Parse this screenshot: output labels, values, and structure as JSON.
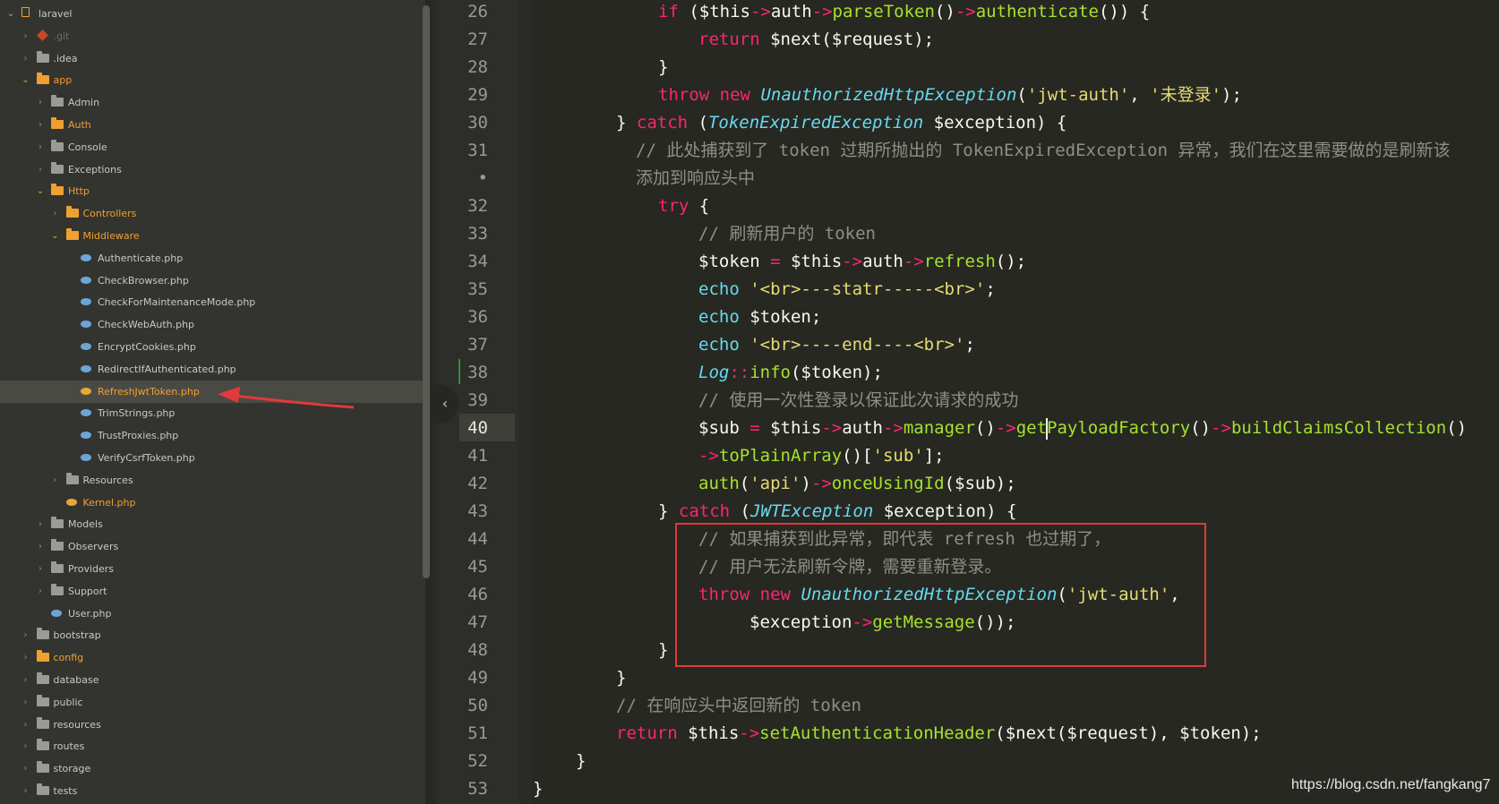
{
  "sidebar": {
    "items": [
      {
        "label": "laravel",
        "kind": "project",
        "chevron": "open",
        "color": "normal",
        "icon": "project-icon"
      },
      {
        "label": ".git",
        "kind": "git",
        "chevron": "closed",
        "color": "dim",
        "icon": "git-icon"
      },
      {
        "label": ".idea",
        "kind": "folder",
        "chevron": "closed",
        "color": "normal",
        "icon": "folder-icon"
      },
      {
        "label": "app",
        "kind": "folder-orange",
        "chevron": "open",
        "color": "orange",
        "icon": "folder-icon"
      },
      {
        "label": "Admin",
        "kind": "folder",
        "chevron": "closed",
        "color": "normal",
        "icon": "folder-icon"
      },
      {
        "label": "Auth",
        "kind": "folder-orange",
        "chevron": "closed",
        "color": "orange",
        "icon": "folder-icon"
      },
      {
        "label": "Console",
        "kind": "folder",
        "chevron": "closed",
        "color": "normal",
        "icon": "folder-icon"
      },
      {
        "label": "Exceptions",
        "kind": "folder",
        "chevron": "closed",
        "color": "normal",
        "icon": "folder-icon"
      },
      {
        "label": "Http",
        "kind": "folder-orange",
        "chevron": "open",
        "color": "orange",
        "icon": "folder-icon"
      },
      {
        "label": "Controllers",
        "kind": "folder-orange",
        "chevron": "closed",
        "color": "orange",
        "icon": "folder-icon"
      },
      {
        "label": "Middleware",
        "kind": "folder-orange",
        "chevron": "open",
        "color": "orange",
        "icon": "folder-icon"
      },
      {
        "label": "Authenticate.php",
        "kind": "php",
        "chevron": "",
        "color": "normal",
        "icon": "php-file-icon"
      },
      {
        "label": "CheckBrowser.php",
        "kind": "php",
        "chevron": "",
        "color": "normal",
        "icon": "php-file-icon"
      },
      {
        "label": "CheckForMaintenanceMode.php",
        "kind": "php",
        "chevron": "",
        "color": "normal",
        "icon": "php-file-icon"
      },
      {
        "label": "CheckWebAuth.php",
        "kind": "php",
        "chevron": "",
        "color": "normal",
        "icon": "php-file-icon"
      },
      {
        "label": "EncryptCookies.php",
        "kind": "php",
        "chevron": "",
        "color": "normal",
        "icon": "php-file-icon"
      },
      {
        "label": "RedirectIfAuthenticated.php",
        "kind": "php",
        "chevron": "",
        "color": "normal",
        "icon": "php-file-icon"
      },
      {
        "label": "RefreshJwtToken.php",
        "kind": "php-orange",
        "chevron": "",
        "color": "orange",
        "icon": "php-file-icon",
        "selected": true
      },
      {
        "label": "TrimStrings.php",
        "kind": "php",
        "chevron": "",
        "color": "normal",
        "icon": "php-file-icon"
      },
      {
        "label": "TrustProxies.php",
        "kind": "php",
        "chevron": "",
        "color": "normal",
        "icon": "php-file-icon"
      },
      {
        "label": "VerifyCsrfToken.php",
        "kind": "php",
        "chevron": "",
        "color": "normal",
        "icon": "php-file-icon"
      },
      {
        "label": "Resources",
        "kind": "folder",
        "chevron": "closed",
        "color": "normal",
        "icon": "folder-icon"
      },
      {
        "label": "Kernel.php",
        "kind": "php-orange",
        "chevron": "",
        "color": "orange",
        "icon": "php-file-icon"
      },
      {
        "label": "Models",
        "kind": "folder",
        "chevron": "closed",
        "color": "normal",
        "icon": "folder-icon"
      },
      {
        "label": "Observers",
        "kind": "folder",
        "chevron": "closed",
        "color": "normal",
        "icon": "folder-icon"
      },
      {
        "label": "Providers",
        "kind": "folder",
        "chevron": "closed",
        "color": "normal",
        "icon": "folder-icon"
      },
      {
        "label": "Support",
        "kind": "folder",
        "chevron": "closed",
        "color": "normal",
        "icon": "folder-icon"
      },
      {
        "label": "User.php",
        "kind": "php",
        "chevron": "",
        "color": "normal",
        "icon": "php-file-icon"
      },
      {
        "label": "bootstrap",
        "kind": "folder",
        "chevron": "closed",
        "color": "normal",
        "icon": "folder-icon"
      },
      {
        "label": "config",
        "kind": "folder-orange",
        "chevron": "closed",
        "color": "orange",
        "icon": "folder-icon"
      },
      {
        "label": "database",
        "kind": "folder",
        "chevron": "closed",
        "color": "normal",
        "icon": "folder-icon"
      },
      {
        "label": "public",
        "kind": "folder",
        "chevron": "closed",
        "color": "normal",
        "icon": "folder-icon"
      },
      {
        "label": "resources",
        "kind": "folder",
        "chevron": "closed",
        "color": "normal",
        "icon": "folder-icon"
      },
      {
        "label": "routes",
        "kind": "folder",
        "chevron": "closed",
        "color": "normal",
        "icon": "folder-icon"
      },
      {
        "label": "storage",
        "kind": "folder",
        "chevron": "closed",
        "color": "normal",
        "icon": "folder-icon"
      },
      {
        "label": "tests",
        "kind": "folder",
        "chevron": "closed",
        "color": "normal",
        "icon": "folder-icon"
      }
    ]
  },
  "editor": {
    "current_line": "40",
    "line_numbers": [
      "26",
      "27",
      "28",
      "29",
      "30",
      "31",
      "•",
      "32",
      "33",
      "34",
      "35",
      "36",
      "37",
      "38",
      "39",
      "40",
      "41",
      "42",
      "43",
      "44",
      "45",
      "46",
      "47",
      "48",
      "49",
      "50",
      "51",
      "52",
      "53"
    ],
    "lines": [
      [
        [
          "k",
          "if"
        ],
        [
          "p",
          " ("
        ],
        [
          "v",
          "$this"
        ],
        [
          "o",
          "->"
        ],
        [
          "p",
          "auth"
        ],
        [
          "o",
          "->"
        ],
        [
          "f",
          "parseToken"
        ],
        [
          "p",
          "()"
        ],
        [
          "o",
          "->"
        ],
        [
          "f",
          "authenticate"
        ],
        [
          "p",
          "()) {"
        ]
      ],
      [
        [
          "k",
          "return"
        ],
        [
          "p",
          " $next($request);"
        ]
      ],
      [
        [
          "p",
          "}"
        ]
      ],
      [
        [
          "k",
          "throw"
        ],
        [
          "p",
          " "
        ],
        [
          "k",
          "new"
        ],
        [
          "p",
          " "
        ],
        [
          "c",
          "UnauthorizedHttpException"
        ],
        [
          "p",
          "("
        ],
        [
          "s",
          "'jwt-auth'"
        ],
        [
          "p",
          ", "
        ],
        [
          "s",
          "'未登录'"
        ],
        [
          "p",
          ");"
        ]
      ],
      [
        [
          "p",
          "} "
        ],
        [
          "k",
          "catch"
        ],
        [
          "p",
          " ("
        ],
        [
          "c",
          "TokenExpiredException"
        ],
        [
          "p",
          " $exception) {"
        ]
      ],
      [
        [
          "m",
          "// 此处捕获到了 token 过期所抛出的 TokenExpiredException 异常，我们在这里需要做的是刷新该"
        ]
      ],
      [
        [
          "m",
          "添加到响应头中"
        ]
      ],
      [
        [
          "k",
          "try"
        ],
        [
          "p",
          " {"
        ]
      ],
      [
        [
          "m",
          "// 刷新用户的 token"
        ]
      ],
      [
        [
          "p",
          "$token "
        ],
        [
          "o",
          "="
        ],
        [
          "p",
          " $this"
        ],
        [
          "o",
          "->"
        ],
        [
          "p",
          "auth"
        ],
        [
          "o",
          "->"
        ],
        [
          "f",
          "refresh"
        ],
        [
          "p",
          "();"
        ]
      ],
      [
        [
          "b",
          "echo"
        ],
        [
          "p",
          " "
        ],
        [
          "s",
          "'<br>---statr-----<br>'"
        ],
        [
          "p",
          ";"
        ]
      ],
      [
        [
          "b",
          "echo"
        ],
        [
          "p",
          " $token;"
        ]
      ],
      [
        [
          "b",
          "echo"
        ],
        [
          "p",
          " "
        ],
        [
          "s",
          "'<br>----end----<br>'"
        ],
        [
          "p",
          ";"
        ]
      ],
      [
        [
          "c",
          "Log"
        ],
        [
          "o",
          "::"
        ],
        [
          "f",
          "info"
        ],
        [
          "p",
          "($token);"
        ]
      ],
      [
        [
          "m",
          "// 使用一次性登录以保证此次请求的成功"
        ]
      ],
      [
        [
          "p",
          "$sub "
        ],
        [
          "o",
          "="
        ],
        [
          "p",
          " $this"
        ],
        [
          "o",
          "->"
        ],
        [
          "p",
          "auth"
        ],
        [
          "o",
          "->"
        ],
        [
          "f",
          "manager"
        ],
        [
          "p",
          "()"
        ],
        [
          "o",
          "->"
        ],
        [
          "f",
          "get"
        ],
        [
          "x",
          ""
        ],
        [
          "f",
          "PayloadFactory"
        ],
        [
          "p",
          "()"
        ],
        [
          "o",
          "->"
        ],
        [
          "f",
          "buildClaimsCollection"
        ],
        [
          "p",
          "()"
        ]
      ],
      [
        [
          "o",
          "->"
        ],
        [
          "f",
          "toPlainArray"
        ],
        [
          "p",
          "()["
        ],
        [
          "s",
          "'sub'"
        ],
        [
          "p",
          "];"
        ]
      ],
      [
        [
          "f",
          "auth"
        ],
        [
          "p",
          "("
        ],
        [
          "s",
          "'api'"
        ],
        [
          "p",
          ")"
        ],
        [
          "o",
          "->"
        ],
        [
          "f",
          "onceUsingId"
        ],
        [
          "p",
          "($sub);"
        ]
      ],
      [
        [
          "p",
          "} "
        ],
        [
          "k",
          "catch"
        ],
        [
          "p",
          " ("
        ],
        [
          "c",
          "JWTException"
        ],
        [
          "p",
          " $exception) {"
        ]
      ],
      [
        [
          "m",
          "// 如果捕获到此异常，即代表 refresh 也过期了，"
        ]
      ],
      [
        [
          "m",
          "// 用户无法刷新令牌，需要重新登录。"
        ]
      ],
      [
        [
          "k",
          "throw"
        ],
        [
          "p",
          " "
        ],
        [
          "k",
          "new"
        ],
        [
          "p",
          " "
        ],
        [
          "c",
          "UnauthorizedHttpException"
        ],
        [
          "p",
          "("
        ],
        [
          "s",
          "'jwt-auth'"
        ],
        [
          "p",
          ","
        ]
      ],
      [
        [
          "p",
          "$exception"
        ],
        [
          "o",
          "->"
        ],
        [
          "f",
          "getMessage"
        ],
        [
          "p",
          "());"
        ]
      ],
      [
        [
          "p",
          "}"
        ]
      ],
      [
        [
          "p",
          "}"
        ]
      ],
      [
        [
          "m",
          "// 在响应头中返回新的 token"
        ]
      ],
      [
        [
          "k",
          "return"
        ],
        [
          "p",
          " $this"
        ],
        [
          "o",
          "->"
        ],
        [
          "f",
          "setAuthenticationHeader"
        ],
        [
          "p",
          "($next($request), $token);"
        ]
      ],
      [
        [
          "p",
          "}"
        ]
      ],
      [
        [
          "p",
          "}"
        ]
      ]
    ]
  },
  "watermark": "https://blog.csdn.net/fangkang7",
  "colors": {
    "editor_bg": "#272822",
    "sidebar_bg": "#33342f",
    "keyword": "#f92672",
    "function": "#a6e22e",
    "class": "#66d9ef",
    "string": "#e6db74",
    "comment": "#8f8f85",
    "annotation": "#e03a3a"
  }
}
